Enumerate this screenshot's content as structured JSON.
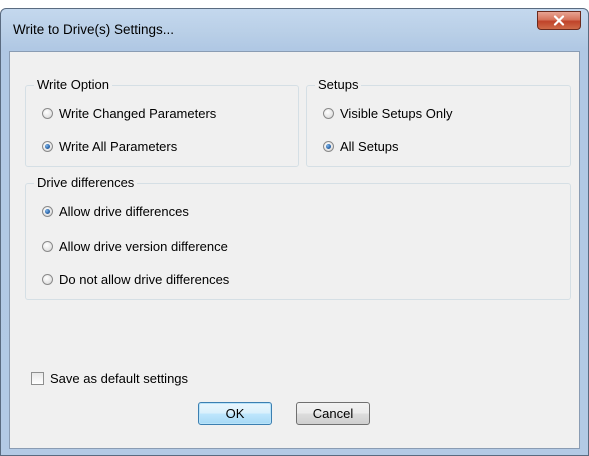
{
  "window": {
    "title": "Write to Drive(s) Settings...",
    "close_symbol": "x"
  },
  "write_option": {
    "title": "Write Option",
    "options": [
      {
        "label": "Write Changed Parameters",
        "checked": false
      },
      {
        "label": "Write All Parameters",
        "checked": true
      }
    ]
  },
  "setups": {
    "title": "Setups",
    "options": [
      {
        "label": "Visible Setups Only",
        "checked": false
      },
      {
        "label": "All Setups",
        "checked": true
      }
    ]
  },
  "drive_differences": {
    "title": "Drive differences",
    "options": [
      {
        "label": "Allow drive differences",
        "checked": true
      },
      {
        "label": "Allow drive version difference",
        "checked": false
      },
      {
        "label": "Do not allow drive differences",
        "checked": false
      }
    ]
  },
  "save_default": {
    "label": "Save as default settings",
    "checked": false
  },
  "buttons": {
    "ok": "OK",
    "cancel": "Cancel"
  },
  "colors": {
    "title_bar": "#b9cfe7",
    "close_button": "#c7462f",
    "dialog_face": "#f0f0f0",
    "radio_selected": "#2a64a8"
  }
}
